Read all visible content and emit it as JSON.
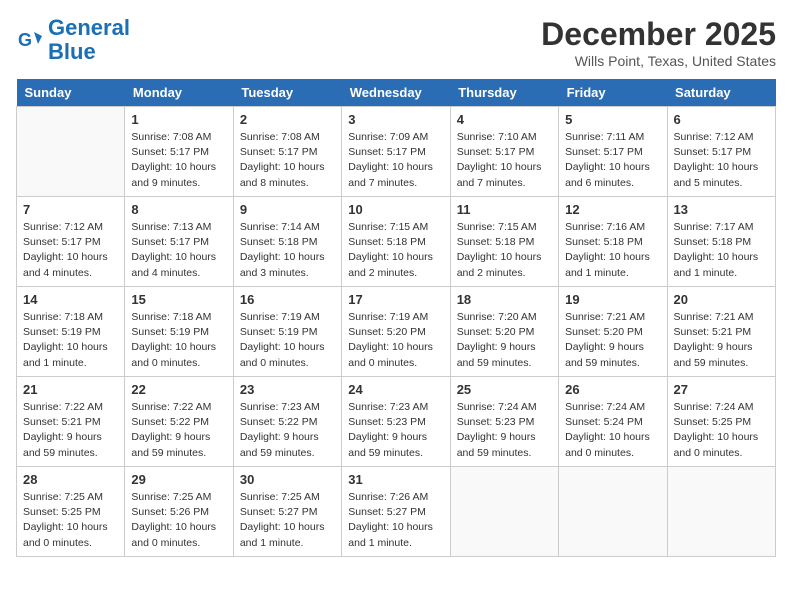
{
  "logo": {
    "line1": "General",
    "line2": "Blue"
  },
  "title": "December 2025",
  "location": "Wills Point, Texas, United States",
  "days_of_week": [
    "Sunday",
    "Monday",
    "Tuesday",
    "Wednesday",
    "Thursday",
    "Friday",
    "Saturday"
  ],
  "weeks": [
    [
      {
        "day": "",
        "sunrise": "",
        "sunset": "",
        "daylight": ""
      },
      {
        "day": "1",
        "sunrise": "7:08 AM",
        "sunset": "5:17 PM",
        "daylight": "10 hours and 9 minutes."
      },
      {
        "day": "2",
        "sunrise": "7:08 AM",
        "sunset": "5:17 PM",
        "daylight": "10 hours and 8 minutes."
      },
      {
        "day": "3",
        "sunrise": "7:09 AM",
        "sunset": "5:17 PM",
        "daylight": "10 hours and 7 minutes."
      },
      {
        "day": "4",
        "sunrise": "7:10 AM",
        "sunset": "5:17 PM",
        "daylight": "10 hours and 7 minutes."
      },
      {
        "day": "5",
        "sunrise": "7:11 AM",
        "sunset": "5:17 PM",
        "daylight": "10 hours and 6 minutes."
      },
      {
        "day": "6",
        "sunrise": "7:12 AM",
        "sunset": "5:17 PM",
        "daylight": "10 hours and 5 minutes."
      }
    ],
    [
      {
        "day": "7",
        "sunrise": "7:12 AM",
        "sunset": "5:17 PM",
        "daylight": "10 hours and 4 minutes."
      },
      {
        "day": "8",
        "sunrise": "7:13 AM",
        "sunset": "5:17 PM",
        "daylight": "10 hours and 4 minutes."
      },
      {
        "day": "9",
        "sunrise": "7:14 AM",
        "sunset": "5:18 PM",
        "daylight": "10 hours and 3 minutes."
      },
      {
        "day": "10",
        "sunrise": "7:15 AM",
        "sunset": "5:18 PM",
        "daylight": "10 hours and 2 minutes."
      },
      {
        "day": "11",
        "sunrise": "7:15 AM",
        "sunset": "5:18 PM",
        "daylight": "10 hours and 2 minutes."
      },
      {
        "day": "12",
        "sunrise": "7:16 AM",
        "sunset": "5:18 PM",
        "daylight": "10 hours and 1 minute."
      },
      {
        "day": "13",
        "sunrise": "7:17 AM",
        "sunset": "5:18 PM",
        "daylight": "10 hours and 1 minute."
      }
    ],
    [
      {
        "day": "14",
        "sunrise": "7:18 AM",
        "sunset": "5:19 PM",
        "daylight": "10 hours and 1 minute."
      },
      {
        "day": "15",
        "sunrise": "7:18 AM",
        "sunset": "5:19 PM",
        "daylight": "10 hours and 0 minutes."
      },
      {
        "day": "16",
        "sunrise": "7:19 AM",
        "sunset": "5:19 PM",
        "daylight": "10 hours and 0 minutes."
      },
      {
        "day": "17",
        "sunrise": "7:19 AM",
        "sunset": "5:20 PM",
        "daylight": "10 hours and 0 minutes."
      },
      {
        "day": "18",
        "sunrise": "7:20 AM",
        "sunset": "5:20 PM",
        "daylight": "9 hours and 59 minutes."
      },
      {
        "day": "19",
        "sunrise": "7:21 AM",
        "sunset": "5:20 PM",
        "daylight": "9 hours and 59 minutes."
      },
      {
        "day": "20",
        "sunrise": "7:21 AM",
        "sunset": "5:21 PM",
        "daylight": "9 hours and 59 minutes."
      }
    ],
    [
      {
        "day": "21",
        "sunrise": "7:22 AM",
        "sunset": "5:21 PM",
        "daylight": "9 hours and 59 minutes."
      },
      {
        "day": "22",
        "sunrise": "7:22 AM",
        "sunset": "5:22 PM",
        "daylight": "9 hours and 59 minutes."
      },
      {
        "day": "23",
        "sunrise": "7:23 AM",
        "sunset": "5:22 PM",
        "daylight": "9 hours and 59 minutes."
      },
      {
        "day": "24",
        "sunrise": "7:23 AM",
        "sunset": "5:23 PM",
        "daylight": "9 hours and 59 minutes."
      },
      {
        "day": "25",
        "sunrise": "7:24 AM",
        "sunset": "5:23 PM",
        "daylight": "9 hours and 59 minutes."
      },
      {
        "day": "26",
        "sunrise": "7:24 AM",
        "sunset": "5:24 PM",
        "daylight": "10 hours and 0 minutes."
      },
      {
        "day": "27",
        "sunrise": "7:24 AM",
        "sunset": "5:25 PM",
        "daylight": "10 hours and 0 minutes."
      }
    ],
    [
      {
        "day": "28",
        "sunrise": "7:25 AM",
        "sunset": "5:25 PM",
        "daylight": "10 hours and 0 minutes."
      },
      {
        "day": "29",
        "sunrise": "7:25 AM",
        "sunset": "5:26 PM",
        "daylight": "10 hours and 0 minutes."
      },
      {
        "day": "30",
        "sunrise": "7:25 AM",
        "sunset": "5:27 PM",
        "daylight": "10 hours and 1 minute."
      },
      {
        "day": "31",
        "sunrise": "7:26 AM",
        "sunset": "5:27 PM",
        "daylight": "10 hours and 1 minute."
      },
      {
        "day": "",
        "sunrise": "",
        "sunset": "",
        "daylight": ""
      },
      {
        "day": "",
        "sunrise": "",
        "sunset": "",
        "daylight": ""
      },
      {
        "day": "",
        "sunrise": "",
        "sunset": "",
        "daylight": ""
      }
    ]
  ],
  "labels": {
    "sunrise": "Sunrise:",
    "sunset": "Sunset:",
    "daylight": "Daylight:"
  }
}
